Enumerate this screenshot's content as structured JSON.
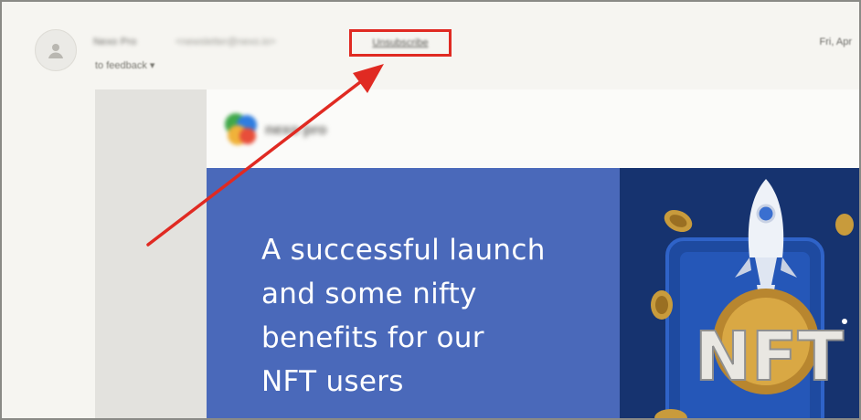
{
  "message_header": {
    "sender_name": "Nexo Pro",
    "sender_email": "<newsletter@nexo.io>",
    "unsubscribe_label": "Unsubscribe",
    "recipient_line": "to feedback ▾",
    "date": "Fri, Apr"
  },
  "email_body": {
    "brand_name": "nexo pro",
    "headline_lines": [
      "A successful launch",
      "and some nifty",
      "benefits for our",
      "NFT users"
    ],
    "art_text": "NFT"
  },
  "colors": {
    "annotation": "#e02a22",
    "banner": "#4a69ba",
    "art_background": "#16336f",
    "coin": "#c89b3c"
  },
  "icons": {
    "avatar": "person-avatar-icon",
    "logo": "brand-logo-icon",
    "rocket": "rocket-icon",
    "coin": "coin-icon",
    "arrow": "annotation-arrow-icon"
  }
}
